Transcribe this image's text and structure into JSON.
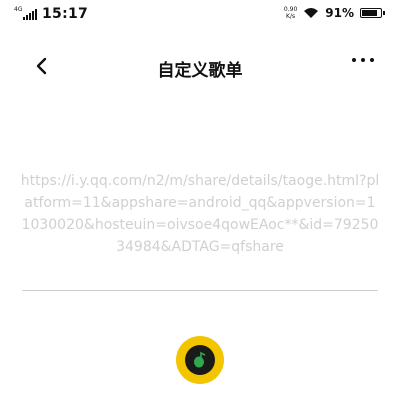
{
  "status_bar": {
    "network": "4G",
    "time": "15:17",
    "speed_value": "0.90",
    "speed_unit": "K/s",
    "battery_percent": "91%",
    "battery_level": 0.91
  },
  "nav": {
    "back_icon": "chevron-left-icon",
    "title": "自定义歌单",
    "more_icon": "more-horizontal-icon"
  },
  "url_text": "https://i.y.qq.com/n2/m/share/details/taoge.html?platform=11&appshare=android_qq&appversion=11030020&hosteuin=oivsoe4qowEAoc**&id=7925034984&ADTAG=qfshare",
  "app_logo": {
    "icon": "qq-music-logo-icon",
    "color": "#f2c500",
    "accent": "#2fa84f"
  }
}
